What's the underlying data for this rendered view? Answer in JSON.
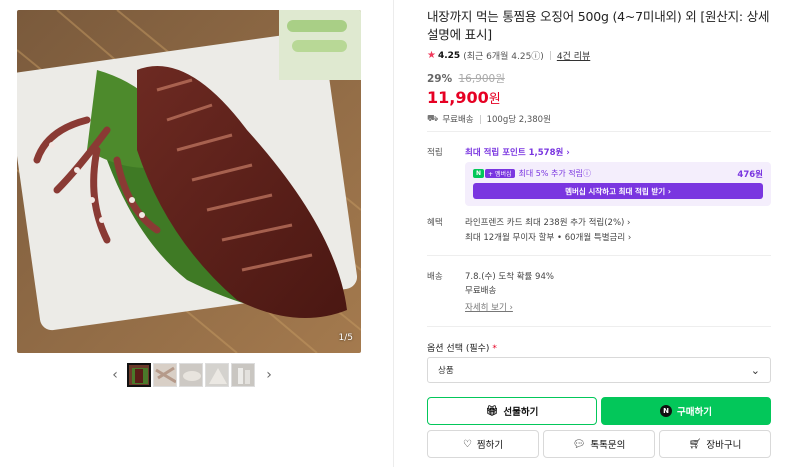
{
  "gallery": {
    "counter": "1/5",
    "thumb_count": 5,
    "prev_label": "‹",
    "next_label": "›"
  },
  "product": {
    "title": "내장까지 먹는 통찜용 오징어 500g (4~7미내외) 외 [원산지: 상세설명에 표시]",
    "rating": "4.25",
    "rating_detail": "(최근 6개월 4.25ⓘ)",
    "review_link": "4건 리뷰",
    "discount": "29%",
    "original_price": "16,900원",
    "sale_price": "11,900",
    "sale_unit": "원",
    "shipping": "무료배송",
    "unit_price": "100g당 2,380원"
  },
  "point": {
    "label": "적립",
    "head": "최대 적립 포인트 1,578원 ›",
    "badge_n": "N",
    "badge_plus": "+ 멤버십",
    "extra": "최대 5% 추가 적립ⓘ",
    "amount": "476원",
    "membership_button": "멤버십 시작하고 최대 적립 받기 ›"
  },
  "benefit": {
    "label": "혜택",
    "line1": "라인프렌즈 카드 최대 238원 추가 적립(2%) ›",
    "line2": "최대 12개월 무이자 할부 • 60개월 특별금리 ›"
  },
  "delivery": {
    "label": "배송",
    "arrival": "7.8.(수) 도착 확률 94%",
    "fee": "무료배송",
    "detail_link": "자세히 보기 ›"
  },
  "option": {
    "label": "옵션 선택 (필수)",
    "required_mark": "*",
    "selected": "상품"
  },
  "buttons": {
    "gift": "선물하기",
    "buy": "구매하기",
    "wish": "찜하기",
    "talk": "톡톡문의",
    "cart": "장바구니"
  },
  "colors": {
    "accent_green": "#03c75a",
    "price_red": "#e60023",
    "membership_purple": "#7a36e0"
  }
}
